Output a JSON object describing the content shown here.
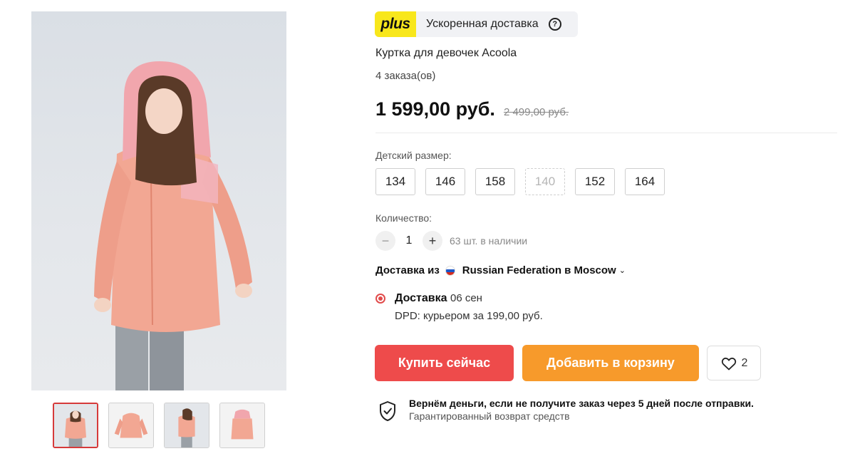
{
  "plus": {
    "badge": "plus",
    "label": "Ускоренная доставка",
    "icon": "question-circle-icon"
  },
  "product": {
    "title": "Куртка для девочек Acoola",
    "orders": "4 заказа(ов)",
    "price": "1 599,00 руб.",
    "old_price": "2 499,00 руб."
  },
  "sizes": {
    "label": "Детский размер:",
    "options": [
      {
        "value": "134",
        "available": true
      },
      {
        "value": "146",
        "available": true
      },
      {
        "value": "158",
        "available": true
      },
      {
        "value": "140",
        "available": false
      },
      {
        "value": "152",
        "available": true
      },
      {
        "value": "164",
        "available": true
      }
    ]
  },
  "quantity": {
    "label": "Количество:",
    "value": "1",
    "minus": "−",
    "plus": "+",
    "stock": "63 шт. в наличии"
  },
  "shipping": {
    "from_label": "Доставка из",
    "origin": "Russian Federation в Moscow",
    "flag_colors": [
      "#ffffff",
      "#1c57c8",
      "#d52b1e"
    ],
    "method_title": "Доставка",
    "date": "06 сен",
    "method_detail": "DPD: курьером за 199,00 руб."
  },
  "actions": {
    "buy_now": "Купить сейчас",
    "add_to_cart": "Добавить в корзину",
    "wishlist_count": "2"
  },
  "guarantee": {
    "title": "Вернём деньги, если не получите заказ через 5 дней после отправки.",
    "subtitle": "Гарантированный возврат средств"
  },
  "colors": {
    "buy": "#ee4b4b",
    "cart": "#f79a2b",
    "plus_badge": "#f8e71c",
    "accent_red": "#d63a3a"
  },
  "gallery": {
    "selected_index": 0,
    "thumbnail_count": 4
  }
}
